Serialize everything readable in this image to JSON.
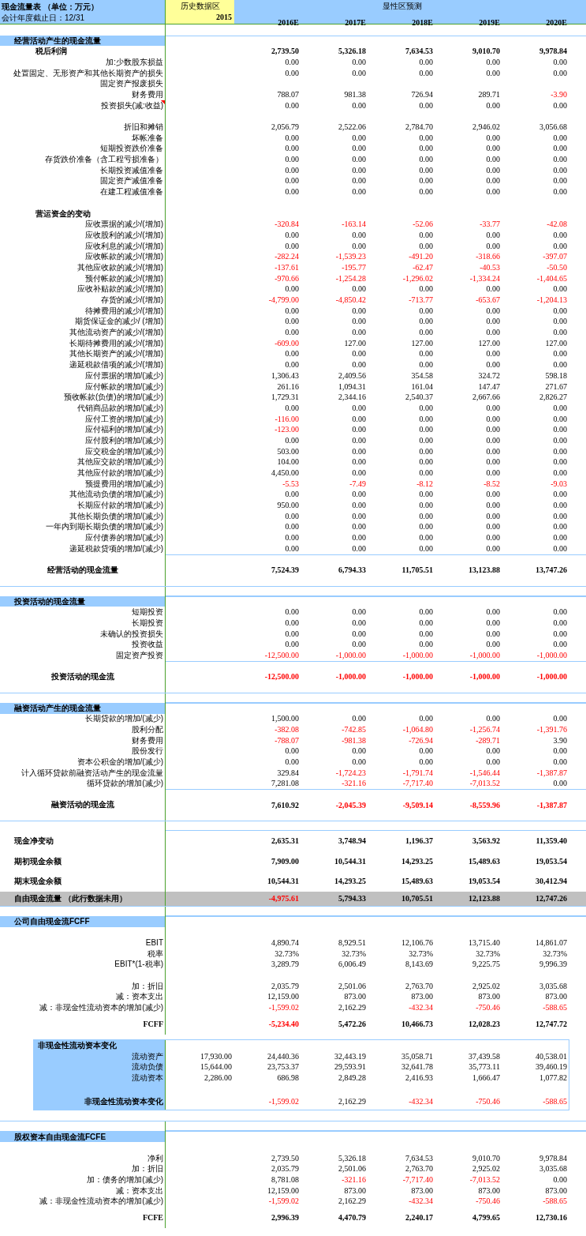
{
  "header": {
    "title": "现金流量表 （单位：万元）",
    "subtitle": "会计年度截止日：12/31",
    "history_label": "历史数据区",
    "forecast_label": "显性区预测",
    "years": [
      "2015",
      "2016E",
      "2017E",
      "2018E",
      "2019E",
      "2020E"
    ]
  },
  "rows": [
    {
      "kind": "blank"
    },
    {
      "kind": "section",
      "label": "经营活动产生的现金流量"
    },
    {
      "kind": "heading",
      "label": "税后利润",
      "values": [
        "2,739.50",
        "5,326.18",
        "7,634.53",
        "9,010.70",
        "9,978.84"
      ]
    },
    {
      "kind": "item",
      "label": "加:少数股东损益",
      "values": [
        "0.00",
        "0.00",
        "0.00",
        "0.00",
        "0.00"
      ]
    },
    {
      "kind": "item",
      "label": "处置固定、无形资产和其他长期资产的损失",
      "values": [
        "0.00",
        "0.00",
        "0.00",
        "0.00",
        "0.00"
      ]
    },
    {
      "kind": "item",
      "label": "固定资产报废损失"
    },
    {
      "kind": "item",
      "label": "财务费用",
      "values": [
        "788.07",
        "981.38",
        "726.94",
        "289.71",
        "-3.90"
      ]
    },
    {
      "kind": "item",
      "label": "投资损失(减:收益)",
      "comment": true,
      "values": [
        "0.00",
        "0.00",
        "0.00",
        "0.00",
        "0.00"
      ]
    },
    {
      "kind": "blank"
    },
    {
      "kind": "item",
      "label": "折旧和摊销",
      "values": [
        "2,056.79",
        "2,522.06",
        "2,784.70",
        "2,946.02",
        "3,056.68"
      ]
    },
    {
      "kind": "item",
      "label": "坏帐准备",
      "values": [
        "0.00",
        "0.00",
        "0.00",
        "0.00",
        "0.00"
      ]
    },
    {
      "kind": "item",
      "label": "短期投资跌价准备",
      "values": [
        "0.00",
        "0.00",
        "0.00",
        "0.00",
        "0.00"
      ]
    },
    {
      "kind": "item",
      "label": "存货跌价准备（含工程亏损准备）",
      "values": [
        "0.00",
        "0.00",
        "0.00",
        "0.00",
        "0.00"
      ]
    },
    {
      "kind": "item",
      "label": "长期投资减值准备",
      "values": [
        "0.00",
        "0.00",
        "0.00",
        "0.00",
        "0.00"
      ]
    },
    {
      "kind": "item",
      "label": "固定资产减值准备",
      "values": [
        "0.00",
        "0.00",
        "0.00",
        "0.00",
        "0.00"
      ]
    },
    {
      "kind": "item",
      "label": "在建工程减值准备",
      "values": [
        "0.00",
        "0.00",
        "0.00",
        "0.00",
        "0.00"
      ]
    },
    {
      "kind": "blank"
    },
    {
      "kind": "heading",
      "label": "营运资金的变动"
    },
    {
      "kind": "item",
      "label": "应收票据的减少/(增加)",
      "values": [
        "-320.84",
        "-163.14",
        "-52.06",
        "-33.77",
        "-42.08"
      ]
    },
    {
      "kind": "item",
      "label": "应收股利的减少/(增加)",
      "values": [
        "0.00",
        "0.00",
        "0.00",
        "0.00",
        "0.00"
      ]
    },
    {
      "kind": "item",
      "label": "应收利息的减少/(增加)",
      "values": [
        "0.00",
        "0.00",
        "0.00",
        "0.00",
        "0.00"
      ]
    },
    {
      "kind": "item",
      "label": "应收帐款的减少/(增加)",
      "values": [
        "-282.24",
        "-1,539.23",
        "-491.20",
        "-318.66",
        "-397.07"
      ]
    },
    {
      "kind": "item",
      "label": "其他应收款的减少/(增加)",
      "values": [
        "-137.61",
        "-195.77",
        "-62.47",
        "-40.53",
        "-50.50"
      ]
    },
    {
      "kind": "item",
      "label": "预付帐款的减少/(增加)",
      "values": [
        "-970.66",
        "-1,254.28",
        "-1,296.02",
        "-1,334.24",
        "-1,404.65"
      ]
    },
    {
      "kind": "item",
      "label": "应收补贴款的减少/(增加)",
      "values": [
        "0.00",
        "0.00",
        "0.00",
        "0.00",
        "0.00"
      ]
    },
    {
      "kind": "item",
      "label": "存货的减少/(增加)",
      "values": [
        "-4,799.00",
        "-4,850.42",
        "-713.77",
        "-653.67",
        "-1,204.13"
      ]
    },
    {
      "kind": "item",
      "label": "待摊费用的减少/(增加)",
      "values": [
        "0.00",
        "0.00",
        "0.00",
        "0.00",
        "0.00"
      ]
    },
    {
      "kind": "item",
      "label": "期货保证金的减少/ (增加)",
      "values": [
        "0.00",
        "0.00",
        "0.00",
        "0.00",
        "0.00"
      ]
    },
    {
      "kind": "item",
      "label": "其他流动资产的减少/(增加)",
      "values": [
        "0.00",
        "0.00",
        "0.00",
        "0.00",
        "0.00"
      ]
    },
    {
      "kind": "item",
      "label": "长期待摊费用的减少/(增加)",
      "values": [
        "-609.00",
        "127.00",
        "127.00",
        "127.00",
        "127.00"
      ]
    },
    {
      "kind": "item",
      "label": "其他长期资产的减少/(增加)",
      "values": [
        "0.00",
        "0.00",
        "0.00",
        "0.00",
        "0.00"
      ]
    },
    {
      "kind": "item",
      "label": "递延税款借项的减少/(增加)",
      "values": [
        "0.00",
        "0.00",
        "0.00",
        "0.00",
        "0.00"
      ]
    },
    {
      "kind": "item",
      "label": "应付票据的增加/(减少)",
      "values": [
        "1,306.43",
        "2,409.56",
        "354.58",
        "324.72",
        "598.18"
      ]
    },
    {
      "kind": "item",
      "label": "应付帐款的增加/(减少)",
      "values": [
        "261.16",
        "1,094.31",
        "161.04",
        "147.47",
        "271.67"
      ]
    },
    {
      "kind": "item",
      "label": "预收帐款(负债)的增加/(减少)",
      "values": [
        "1,729.31",
        "2,344.16",
        "2,540.37",
        "2,667.66",
        "2,826.27"
      ]
    },
    {
      "kind": "item",
      "label": "代销商品款的增加/(减少)",
      "values": [
        "0.00",
        "0.00",
        "0.00",
        "0.00",
        "0.00"
      ]
    },
    {
      "kind": "item",
      "label": "应付工资的增加/(减少)",
      "values": [
        "-116.00",
        "0.00",
        "0.00",
        "0.00",
        "0.00"
      ]
    },
    {
      "kind": "item",
      "label": "应付福利的增加/(减少)",
      "values": [
        "-123.00",
        "0.00",
        "0.00",
        "0.00",
        "0.00"
      ]
    },
    {
      "kind": "item",
      "label": "应付股利的增加/(减少)",
      "values": [
        "0.00",
        "0.00",
        "0.00",
        "0.00",
        "0.00"
      ]
    },
    {
      "kind": "item",
      "label": "应交税金的增加/(减少)",
      "values": [
        "503.00",
        "0.00",
        "0.00",
        "0.00",
        "0.00"
      ]
    },
    {
      "kind": "item",
      "label": "其他应交款的增加/(减少)",
      "values": [
        "104.00",
        "0.00",
        "0.00",
        "0.00",
        "0.00"
      ]
    },
    {
      "kind": "item",
      "label": "其他应付款的增加/(减少)",
      "values": [
        "4,450.00",
        "0.00",
        "0.00",
        "0.00",
        "0.00"
      ]
    },
    {
      "kind": "item",
      "label": "预提费用的增加/(减少)",
      "values": [
        "-5.53",
        "-7.49",
        "-8.12",
        "-8.52",
        "-9.03"
      ]
    },
    {
      "kind": "item",
      "label": "其他流动负债的增加/(减少)",
      "values": [
        "0.00",
        "0.00",
        "0.00",
        "0.00",
        "0.00"
      ]
    },
    {
      "kind": "item",
      "label": "长期应付款的增加/(减少)",
      "values": [
        "950.00",
        "0.00",
        "0.00",
        "0.00",
        "0.00"
      ]
    },
    {
      "kind": "item",
      "label": "其他长期负债的增加/(减少)",
      "values": [
        "0.00",
        "0.00",
        "0.00",
        "0.00",
        "0.00"
      ]
    },
    {
      "kind": "item",
      "label": "一年内到期长期负债的增加/(减少)",
      "values": [
        "0.00",
        "0.00",
        "0.00",
        "0.00",
        "0.00"
      ]
    },
    {
      "kind": "item",
      "label": "应付债券的增加/(减少)",
      "values": [
        "0.00",
        "0.00",
        "0.00",
        "0.00",
        "0.00"
      ]
    },
    {
      "kind": "item",
      "label": "递延税款贷项的增加/(减少)",
      "values": [
        "0.00",
        "0.00",
        "0.00",
        "0.00",
        "0.00"
      ]
    },
    {
      "kind": "total",
      "label": "经营活动的现金流量",
      "values": [
        "7,524.39",
        "6,794.33",
        "11,705.51",
        "13,123.88",
        "13,747.26"
      ]
    },
    {
      "kind": "break"
    },
    {
      "kind": "section",
      "label": "投资活动的现金流量"
    },
    {
      "kind": "item",
      "label": "短期投资",
      "values": [
        "0.00",
        "0.00",
        "0.00",
        "0.00",
        "0.00"
      ]
    },
    {
      "kind": "item",
      "label": "长期投资",
      "values": [
        "0.00",
        "0.00",
        "0.00",
        "0.00",
        "0.00"
      ]
    },
    {
      "kind": "item",
      "label": "未确认的投资损失",
      "values": [
        "0.00",
        "0.00",
        "0.00",
        "0.00",
        "0.00"
      ]
    },
    {
      "kind": "item",
      "label": "投资收益",
      "values": [
        "0.00",
        "0.00",
        "0.00",
        "0.00",
        "0.00"
      ]
    },
    {
      "kind": "item",
      "label": "固定资产投资",
      "values": [
        "-12,500.00",
        "-1,000.00",
        "-1,000.00",
        "-1,000.00",
        "-1,000.00"
      ]
    },
    {
      "kind": "total",
      "label": "投资活动的现金流",
      "values": [
        "-12,500.00",
        "-1,000.00",
        "-1,000.00",
        "-1,000.00",
        "-1,000.00"
      ]
    },
    {
      "kind": "break"
    },
    {
      "kind": "section",
      "label": "融资活动产生的现金流量"
    },
    {
      "kind": "item",
      "label": "长期贷款的增加/(减少)",
      "values": [
        "1,500.00",
        "0.00",
        "0.00",
        "0.00",
        "0.00"
      ]
    },
    {
      "kind": "item",
      "label": "股利分配",
      "values": [
        "-382.08",
        "-742.85",
        "-1,064.80",
        "-1,256.74",
        "-1,391.76"
      ]
    },
    {
      "kind": "item",
      "label": "财务费用",
      "values": [
        "-788.07",
        "-981.38",
        "-726.94",
        "-289.71",
        "3.90"
      ]
    },
    {
      "kind": "item",
      "label": "股份发行",
      "values": [
        "0.00",
        "0.00",
        "0.00",
        "0.00",
        "0.00"
      ]
    },
    {
      "kind": "item",
      "label": "资本公积金的增加/(减少)",
      "values": [
        "0.00",
        "0.00",
        "0.00",
        "0.00",
        "0.00"
      ]
    },
    {
      "kind": "item",
      "label": "计入循环贷款前融资活动产生的现金流量",
      "values": [
        "329.84",
        "-1,724.23",
        "-1,791.74",
        "-1,546.44",
        "-1,387.87"
      ]
    },
    {
      "kind": "item",
      "label": "循环贷款的增加(减少)",
      "values": [
        "7,281.08",
        "-321.16",
        "-7,717.40",
        "-7,013.52",
        "0.00"
      ]
    },
    {
      "kind": "total",
      "label": "融资活动的现金流",
      "values": [
        "7,610.92",
        "-2,045.39",
        "-9,509.14",
        "-8,559.96",
        "-1,387.87"
      ]
    },
    {
      "kind": "break"
    },
    {
      "kind": "summary",
      "label": "现金净变动",
      "values": [
        "2,635.31",
        "3,748.94",
        "1,196.37",
        "3,563.92",
        "11,359.40"
      ]
    },
    {
      "kind": "summary",
      "label": "期初现金余额",
      "values": [
        "7,909.00",
        "10,544.31",
        "14,293.25",
        "15,489.63",
        "19,053.54"
      ]
    },
    {
      "kind": "summary",
      "label": "期末现金余额",
      "values": [
        "10,544.31",
        "14,293.25",
        "15,489.63",
        "19,053.54",
        "30,412.94"
      ]
    },
    {
      "kind": "highlight",
      "label": "自由现金流量 （此行数据未用）",
      "values": [
        "-4,975.61",
        "5,794.33",
        "10,705.51",
        "12,123.88",
        "12,747.26"
      ]
    },
    {
      "kind": "break"
    },
    {
      "kind": "section",
      "label": "公司自由现金流FCFF"
    },
    {
      "kind": "blank"
    },
    {
      "kind": "item",
      "label": "EBIT",
      "values": [
        "4,890.74",
        "8,929.51",
        "12,106.76",
        "13,715.40",
        "14,861.07"
      ]
    },
    {
      "kind": "item",
      "label": "税率",
      "values": [
        "32.73%",
        "32.73%",
        "32.73%",
        "32.73%",
        "32.73%"
      ]
    },
    {
      "kind": "item",
      "label": "EBIT*(1-税率)",
      "values": [
        "3,289.79",
        "6,006.49",
        "8,143.69",
        "9,225.75",
        "9,996.39"
      ]
    },
    {
      "kind": "blank"
    },
    {
      "kind": "item",
      "label": "加：折旧",
      "values": [
        "2,035.79",
        "2,501.06",
        "2,763.70",
        "2,925.02",
        "3,035.68"
      ]
    },
    {
      "kind": "item",
      "label": "减：资本支出",
      "values": [
        "12,159.00",
        "873.00",
        "873.00",
        "873.00",
        "873.00"
      ]
    },
    {
      "kind": "item",
      "label": "减：非现金性流动资本的增加(减少)",
      "values": [
        "-1,599.02",
        "2,162.29",
        "-432.34",
        "-750.46",
        "-588.65"
      ]
    },
    {
      "kind": "result",
      "label": "FCFF",
      "values": [
        "-5,234.40",
        "5,472.26",
        "10,466.73",
        "12,028.23",
        "12,747.72"
      ]
    },
    {
      "kind": "panel",
      "rows": [
        {
          "kind": "heading",
          "label": "非现金性流动资本变化"
        },
        {
          "kind": "item",
          "label": "流动资产",
          "history": "17,930.00",
          "values": [
            "24,440.36",
            "32,443.19",
            "35,058.71",
            "37,439.58",
            "40,538.01"
          ]
        },
        {
          "kind": "item",
          "label": "流动负债",
          "history": "15,644.00",
          "values": [
            "23,753.37",
            "29,593.91",
            "32,641.78",
            "35,773.11",
            "39,460.19"
          ]
        },
        {
          "kind": "item",
          "label": "流动资本",
          "history": "2,286.00",
          "values": [
            "686.98",
            "2,849.28",
            "2,416.93",
            "1,666.47",
            "1,077.82"
          ]
        },
        {
          "kind": "blank"
        },
        {
          "kind": "subtotal",
          "label": "非现金性流动资本变化",
          "values": [
            "-1,599.02",
            "2,162.29",
            "-432.34",
            "-750.46",
            "-588.65"
          ]
        }
      ]
    },
    {
      "kind": "break"
    },
    {
      "kind": "section",
      "label": "股权资本自由现金流FCFE"
    },
    {
      "kind": "blank"
    },
    {
      "kind": "item",
      "label": "净利",
      "values": [
        "2,739.50",
        "5,326.18",
        "7,634.53",
        "9,010.70",
        "9,978.84"
      ]
    },
    {
      "kind": "item",
      "label": "加：折旧",
      "values": [
        "2,035.79",
        "2,501.06",
        "2,763.70",
        "2,925.02",
        "3,035.68"
      ]
    },
    {
      "kind": "item",
      "label": "加：债务的增加(减少)",
      "values": [
        "8,781.08",
        "-321.16",
        "-7,717.40",
        "-7,013.52",
        "0.00"
      ]
    },
    {
      "kind": "item",
      "label": "减：资本支出",
      "values": [
        "12,159.00",
        "873.00",
        "873.00",
        "873.00",
        "873.00"
      ]
    },
    {
      "kind": "item",
      "label": "减：非现金性流动资本的增加(减少)",
      "values": [
        "-1,599.02",
        "2,162.29",
        "-432.34",
        "-750.46",
        "-588.65"
      ]
    },
    {
      "kind": "result",
      "label": "FCFE",
      "values": [
        "2,996.39",
        "4,470.79",
        "2,240.17",
        "4,799.65",
        "12,730.16"
      ]
    }
  ]
}
